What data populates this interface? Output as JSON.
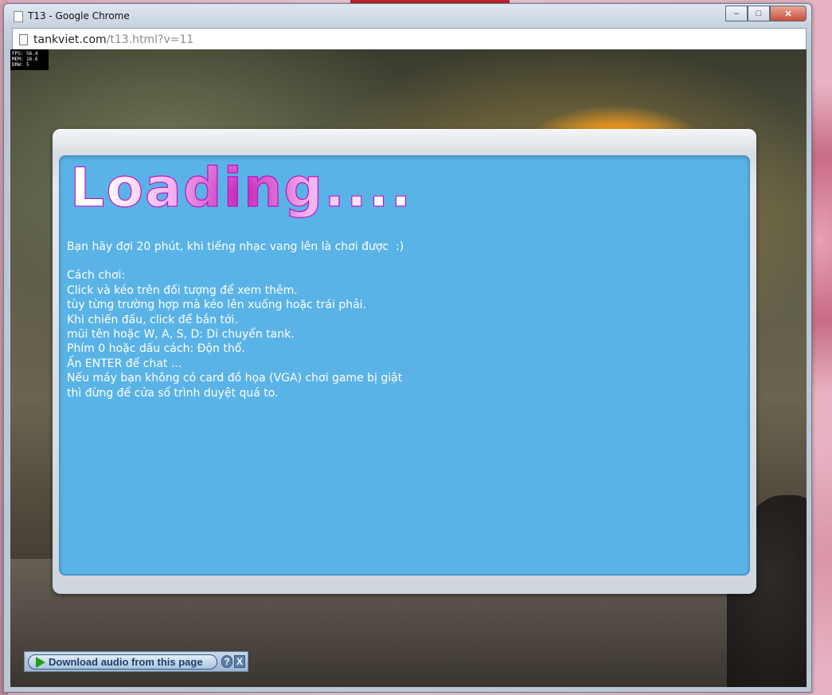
{
  "window": {
    "title": "T13 - Google Chrome",
    "controls": {
      "minimize": "–",
      "maximize": "□",
      "close": "✕"
    }
  },
  "address": {
    "host": "tankviet.com",
    "path": "/t13.html?v=11"
  },
  "stats": {
    "fps": "FPS: 56.4",
    "mem": "MEM: 16.6",
    "drw": "DRW: 5"
  },
  "dialog": {
    "heading": "Loading....",
    "lines": [
      "Bạn hãy đợi 20 phút, khi tiếng nhạc vang lên là chơi được  :)",
      "",
      "Cách chơi:",
      "Click và kéo trên đối tượng để xem thêm.",
      "tùy từng trường hợp mà kéo lên xuống hoặc trái phải.",
      "Khi chiến đấu, click để bắn tới.",
      "mũi tên hoặc W, A, S, D: Di chuyển tank.",
      "Phím 0 hoặc dấu cách: Độn thổ.",
      "Ấn ENTER để chat ...",
      "Nếu máy bạn không có card đồ họa (VGA) chơi game bị giật",
      "thì đừng để cửa sổ trình duyệt quá to."
    ]
  },
  "audio_bar": {
    "label": "Download audio from this page",
    "help": "?",
    "close": "X"
  }
}
